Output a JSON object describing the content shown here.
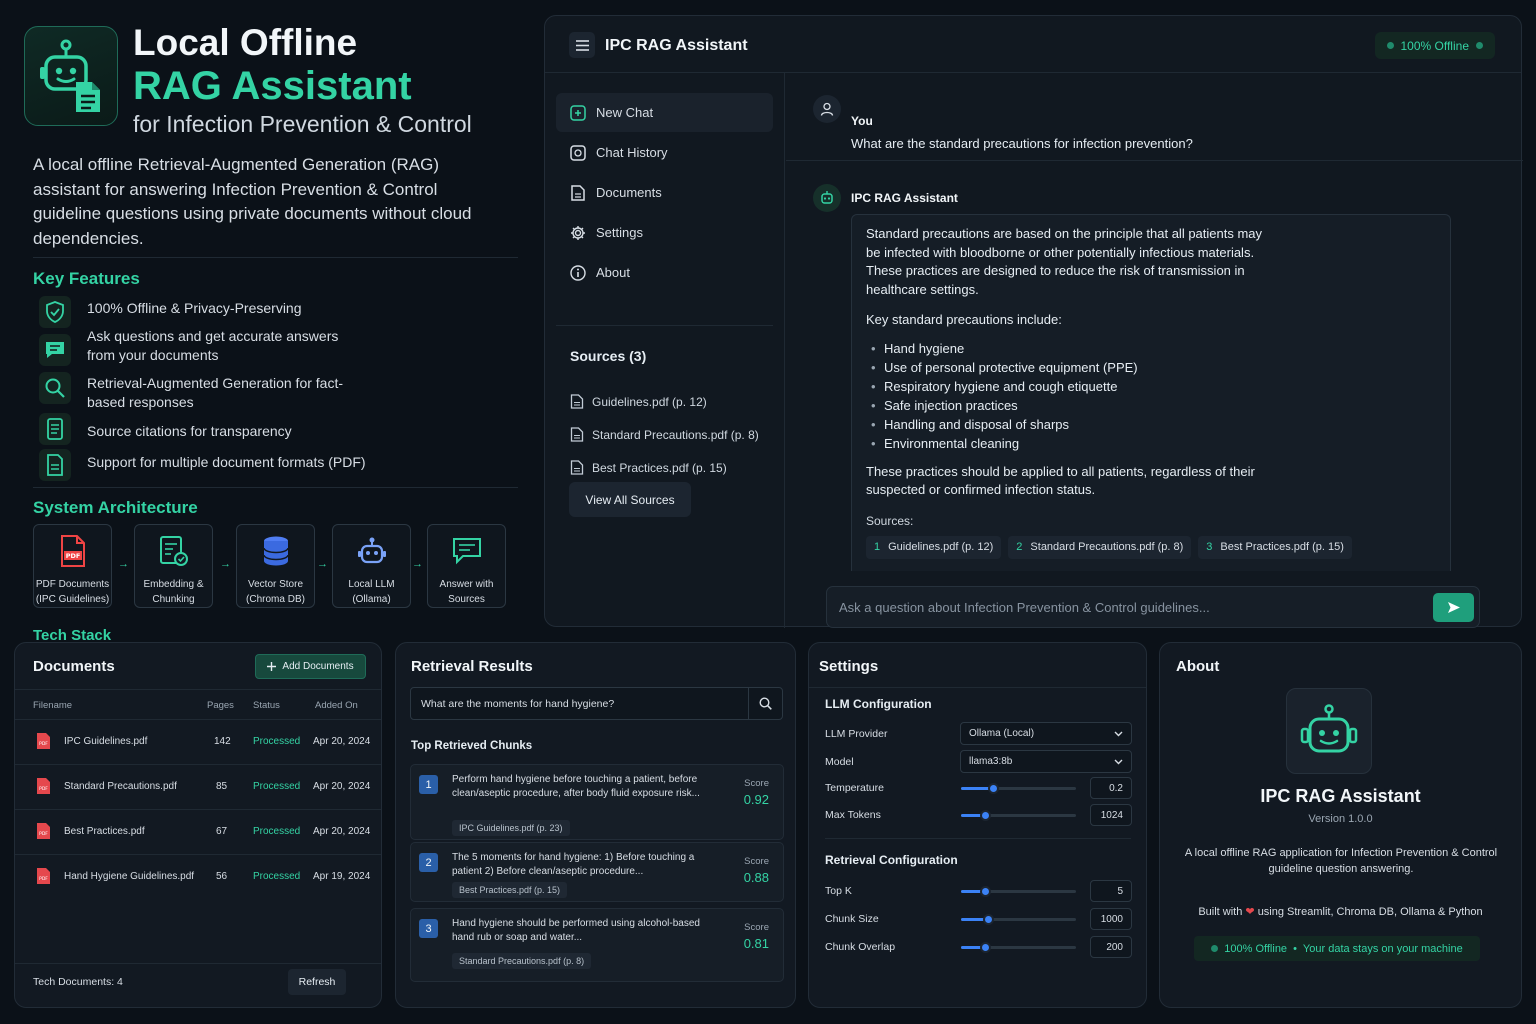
{
  "hero": {
    "title_line1": "Local Offline",
    "title_line2": "RAG Assistant",
    "title_line3": "for Infection Prevention & Control",
    "description": "A local offline Retrieval-Augmented Generation (RAG) assistant for answering Infection Prevention & Control guideline questions using private documents without cloud dependencies."
  },
  "features": {
    "title": "Key Features",
    "items": [
      {
        "icon": "shield-check-icon",
        "text": "100% Offline & Privacy-Preserving"
      },
      {
        "icon": "chat-icon",
        "text": "Ask questions and get accurate answers from your documents"
      },
      {
        "icon": "search-icon",
        "text": "Retrieval-Augmented Generation for fact-based responses"
      },
      {
        "icon": "document-icon",
        "text": "Source citations for transparency"
      },
      {
        "icon": "file-icon",
        "text": "Support for multiple document formats (PDF)"
      }
    ]
  },
  "architecture": {
    "title": "System Architecture",
    "steps": [
      {
        "line1": "PDF Documents",
        "line2": "(IPC Guidelines)",
        "icon": "pdf-icon"
      },
      {
        "line1": "Embedding &",
        "line2": "Chunking",
        "icon": "embedding-icon"
      },
      {
        "line1": "Vector Store",
        "line2": "(Chroma DB)",
        "icon": "database-icon"
      },
      {
        "line1": "Local LLM",
        "line2": "(Ollama)",
        "icon": "robot-icon"
      },
      {
        "line1": "Answer with",
        "line2": "Sources",
        "icon": "answer-icon"
      }
    ],
    "arrow": "→"
  },
  "tech_stack_title": "Tech Stack",
  "chat": {
    "title": "IPC RAG Assistant",
    "offline_badge": "100% Offline",
    "nav": [
      "New Chat",
      "Chat History",
      "Documents",
      "Settings",
      "About"
    ],
    "sources_title": "Sources (3)",
    "sources": [
      "Guidelines.pdf (p. 12)",
      "Standard Precautions.pdf (p. 8)",
      "Best Practices.pdf (p. 15)"
    ],
    "view_all": "View All Sources",
    "user_name": "You",
    "user_message": "What are the standard precautions for infection prevention?",
    "assistant_name": "IPC RAG Assistant",
    "answer_intro": "Standard precautions are based on the principle that all patients may be infected with bloodborne or other potentially infectious materials. These practices are designed to reduce the risk of transmission in healthcare settings.",
    "answer_list_title": "Key standard precautions include:",
    "answer_list": [
      "Hand hygiene",
      "Use of personal protective equipment (PPE)",
      "Respiratory hygiene and cough etiquette",
      "Safe injection practices",
      "Handling and disposal of sharps",
      "Environmental cleaning"
    ],
    "answer_outro": "These practices should be applied to all patients, regardless of their suspected or confirmed infection status.",
    "sources_label": "Sources:",
    "chips": [
      {
        "n": "1",
        "label": "Guidelines.pdf (p. 12)"
      },
      {
        "n": "2",
        "label": "Standard Precautions.pdf (p. 8)"
      },
      {
        "n": "3",
        "label": "Best Practices.pdf (p. 15)"
      }
    ],
    "input_placeholder": "Ask a question about Infection Prevention & Control guidelines..."
  },
  "documents": {
    "title": "Documents",
    "add_button": "Add Documents",
    "columns": [
      "Filename",
      "Pages",
      "Status",
      "Added On"
    ],
    "rows": [
      {
        "filename": "IPC Guidelines.pdf",
        "pages": "142",
        "status": "Processed",
        "added": "Apr 20, 2024"
      },
      {
        "filename": "Standard Precautions.pdf",
        "pages": "85",
        "status": "Processed",
        "added": "Apr 20, 2024"
      },
      {
        "filename": "Best Practices.pdf",
        "pages": "67",
        "status": "Processed",
        "added": "Apr 20, 2024"
      },
      {
        "filename": "Hand Hygiene Guidelines.pdf",
        "pages": "56",
        "status": "Processed",
        "added": "Apr 19, 2024"
      }
    ],
    "footer": "Tech Documents: 4",
    "refresh": "Refresh"
  },
  "retrieval": {
    "title": "Retrieval Results",
    "query": "What are the moments for hand hygiene?",
    "chunks_title": "Top Retrieved Chunks",
    "score_label": "Score",
    "chunks": [
      {
        "n": "1",
        "text": "Perform hand hygiene before touching a patient, before clean/aseptic procedure, after body fluid exposure risk...",
        "source": "IPC Guidelines.pdf (p. 23)",
        "score": "0.92"
      },
      {
        "n": "2",
        "text": "The 5 moments for hand hygiene: 1) Before touching a patient 2) Before clean/aseptic procedure...",
        "source": "Best Practices.pdf (p. 15)",
        "score": "0.88"
      },
      {
        "n": "3",
        "text": "Hand hygiene should be performed using alcohol-based hand rub or soap and water...",
        "source": "Standard Precautions.pdf (p. 8)",
        "score": "0.81"
      }
    ]
  },
  "settings": {
    "title": "Settings",
    "llm_title": "LLM Configuration",
    "llm_provider_label": "LLM Provider",
    "llm_provider": "Ollama (Local)",
    "model_label": "Model",
    "model": "llama3:8b",
    "temperature_label": "Temperature",
    "temperature": "0.2",
    "temperature_fraction": 0.28,
    "max_tokens_label": "Max Tokens",
    "max_tokens": "1024",
    "max_tokens_fraction": 0.21,
    "retrieval_title": "Retrieval Configuration",
    "top_k_label": "Top K",
    "top_k": "5",
    "top_k_fraction": 0.21,
    "chunk_size_label": "Chunk Size",
    "chunk_size": "1000",
    "chunk_size_fraction": 0.24,
    "chunk_overlap_label": "Chunk Overlap",
    "chunk_overlap": "200",
    "chunk_overlap_fraction": 0.21,
    "accent_color": "#3b82f6"
  },
  "about": {
    "title": "About",
    "name": "IPC RAG Assistant",
    "version": "Version 1.0.0",
    "description": "A local offline RAG application for Infection Prevention & Control guideline question answering.",
    "built_prefix": "Built with",
    "built_suffix": "using Streamlit, Chroma DB, Ollama & Python",
    "offline_label": "100% Offline",
    "offline_separator": "•",
    "offline_tagline": "Your data stays on your machine"
  },
  "colors": {
    "accent": "#34d3a4",
    "background": "#0b1118",
    "panel": "#121922"
  }
}
